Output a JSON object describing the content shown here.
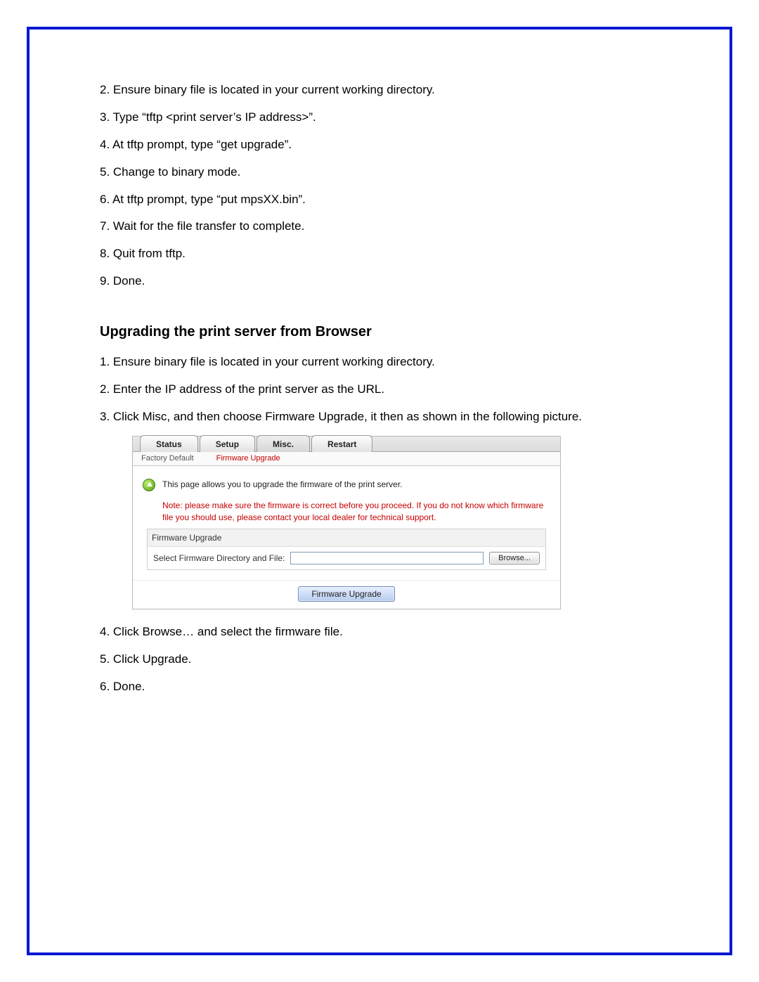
{
  "steps_a": [
    "2. Ensure binary file is located in your current working directory.",
    "3. Type “tftp <print server’s IP address>”.",
    "4. At tftp prompt, type “get upgrade”.",
    "5. Change to binary mode.",
    "6. At tftp prompt, type “put mpsXX.bin”.",
    "7. Wait for the file transfer to complete.",
    "8. Quit from tftp.",
    "9. Done."
  ],
  "heading": "Upgrading the print server from Browser",
  "steps_b": [
    "1. Ensure binary file is located in your current working directory.",
    "2. Enter the IP address of the print server as the URL.",
    "3. Click Misc, and then choose Firmware Upgrade, it then as shown in the following picture."
  ],
  "ui": {
    "tabs": {
      "status": "Status",
      "setup": "Setup",
      "misc": "Misc.",
      "restart": "Restart"
    },
    "submenu": {
      "factory": "Factory Default",
      "fw": "Firmware Upgrade"
    },
    "info": "This page allows you to upgrade the firmware of the print server.",
    "note_label": "Note:",
    "note_body": "please make sure the firmware is correct before you proceed. If you do not know which firmware file you should use, please contact your local dealer for technical support.",
    "box_title": "Firmware Upgrade",
    "select_label": "Select Firmware Directory and File:",
    "browse": "Browse...",
    "upgrade_btn": "Firmware Upgrade"
  },
  "steps_c": [
    "4. Click Browse… and select the firmware file.",
    "5. Click Upgrade.",
    "6. Done."
  ]
}
